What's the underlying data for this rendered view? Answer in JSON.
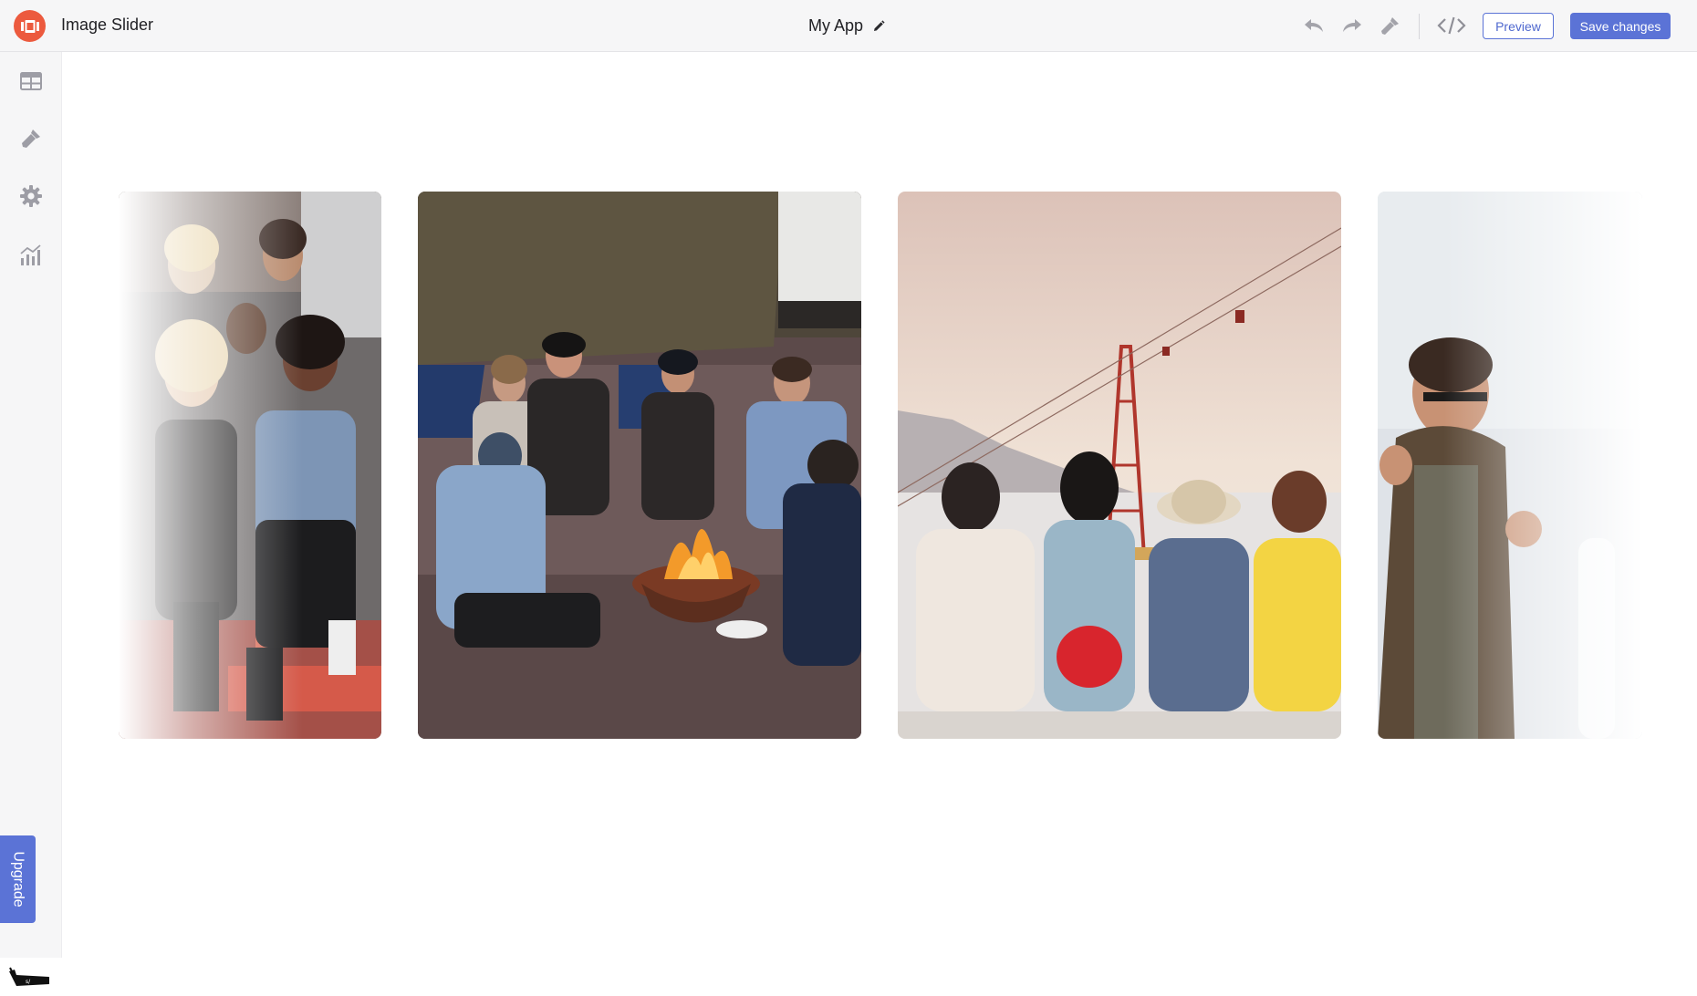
{
  "header": {
    "app_name": "Image Slider",
    "project_title": "My App",
    "preview_label": "Preview",
    "save_label": "Save changes"
  },
  "sidebar": {
    "items": [
      {
        "icon": "layout-table-icon"
      },
      {
        "icon": "brush-icon"
      },
      {
        "icon": "gear-icon"
      },
      {
        "icon": "analytics-icon"
      }
    ],
    "upgrade_label": "Upgrade"
  },
  "slider": {
    "slides": [
      {
        "subject": "group of friends sitting on stairs"
      },
      {
        "subject": "friends around a beach campfire"
      },
      {
        "subject": "friends with arms around each other facing cable car"
      },
      {
        "subject": "man with sunglasses laughing"
      }
    ]
  },
  "colors": {
    "accent": "#5b73d6",
    "logo": "#ec5a3e",
    "topbar_bg": "#f6f6f7"
  }
}
